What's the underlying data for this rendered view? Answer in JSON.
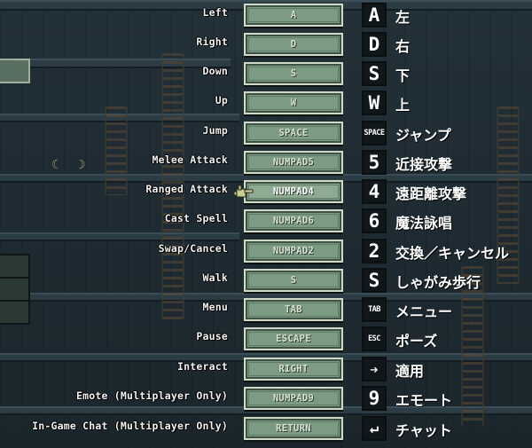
{
  "controls": [
    {
      "action": "Left",
      "key": "A",
      "glyph": "A",
      "jp": "左"
    },
    {
      "action": "Right",
      "key": "D",
      "glyph": "D",
      "jp": "右"
    },
    {
      "action": "Down",
      "key": "S",
      "glyph": "S",
      "jp": "下"
    },
    {
      "action": "Up",
      "key": "W",
      "glyph": "W",
      "jp": "上"
    },
    {
      "action": "Jump",
      "key": "SPACE",
      "glyph": "SPACE",
      "jp": "ジャンプ"
    },
    {
      "action": "Melee Attack",
      "key": "NUMPAD5",
      "glyph": "5",
      "jp": "近接攻撃"
    },
    {
      "action": "Ranged Attack",
      "key": "NUMPAD4",
      "glyph": "4",
      "jp": "遠距離攻撃"
    },
    {
      "action": "Cast Spell",
      "key": "NUMPAD6",
      "glyph": "6",
      "jp": "魔法詠唱"
    },
    {
      "action": "Swap/Cancel",
      "key": "NUMPAD2",
      "glyph": "2",
      "jp": "交換／キャンセル"
    },
    {
      "action": "Walk",
      "key": "S",
      "glyph": "S",
      "jp": "しゃがみ歩行"
    },
    {
      "action": "Menu",
      "key": "TAB",
      "glyph": "TAB",
      "jp": "メニュー"
    },
    {
      "action": "Pause",
      "key": "ESCAPE",
      "glyph": "ESC",
      "jp": "ポーズ"
    },
    {
      "action": "Interact",
      "key": "RIGHT",
      "glyph": "➔",
      "jp": "適用"
    },
    {
      "action": "Emote (Multiplayer Only)",
      "key": "NUMPAD9",
      "glyph": "9",
      "jp": "エモート"
    },
    {
      "action": "In-Game Chat (Multiplayer Only)",
      "key": "RETURN",
      "glyph": "↵",
      "jp": "チャット"
    }
  ],
  "selected_action": "Ranged Attack",
  "colors": {
    "key_face": "#7d9a82",
    "key_border": "#cfd9c6",
    "label": "#f2f2f2",
    "background": "#1d2a30"
  },
  "icons": {
    "cursor": "pointer-hand-icon"
  }
}
